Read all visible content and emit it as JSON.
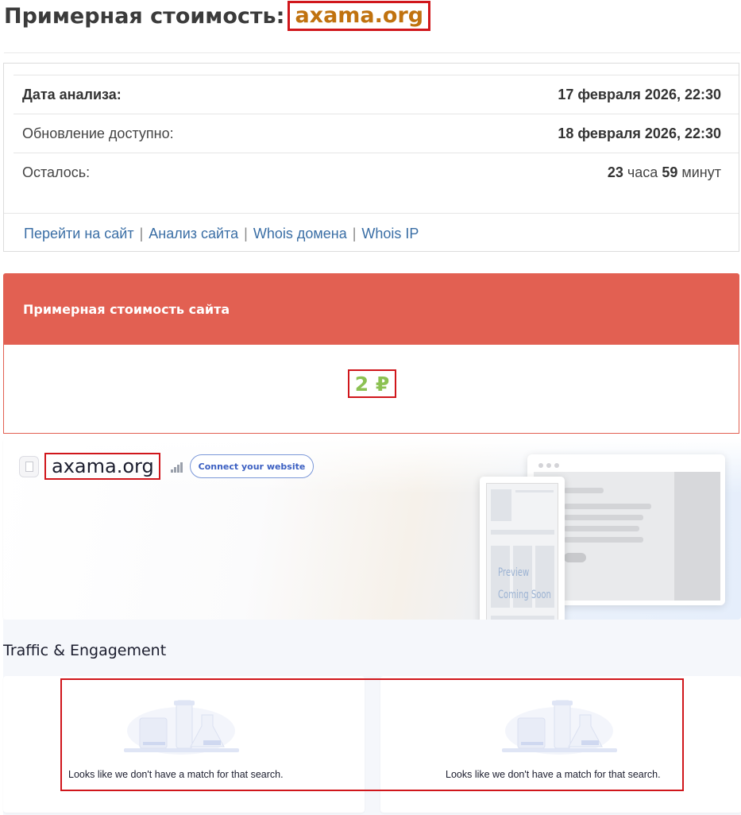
{
  "header": {
    "title_prefix": "Примерная стоимость:",
    "domain": "axama.org"
  },
  "info": {
    "rows": [
      {
        "label": "Дата анализа:",
        "value": "17 февраля 2026, 22:30"
      },
      {
        "label": "Обновление доступно:",
        "value": "18 февраля 2026, 22:30"
      }
    ],
    "remaining": {
      "label": "Осталось:",
      "hours": "23",
      "hours_word": "часа",
      "minutes": "59",
      "minutes_word": "минут"
    },
    "links": [
      "Перейти на сайт",
      "Анализ сайта",
      "Whois домена",
      "Whois IP"
    ],
    "separator": "|"
  },
  "price": {
    "heading": "Примерная стоимость сайта",
    "value": "2 ₽"
  },
  "site_card": {
    "name": "axama.org",
    "connect_label": "Connect your website",
    "preview_line1": "Preview",
    "preview_line2": "Coming Soon"
  },
  "traffic": {
    "title": "Traffic & Engagement",
    "empty_message": "Looks like we don't have a match for that search."
  },
  "colors": {
    "accent_red": "#e26052",
    "price_green": "#8cc152",
    "domain_orange": "#c0720f",
    "link_blue": "#3a6ea5",
    "connect_blue": "#3c60c2",
    "highlight_red": "#d0161b"
  },
  "icons": {
    "favicon": "page-icon",
    "rank": "signal-bars-icon",
    "empty_state": "lab-flask-illustration"
  }
}
